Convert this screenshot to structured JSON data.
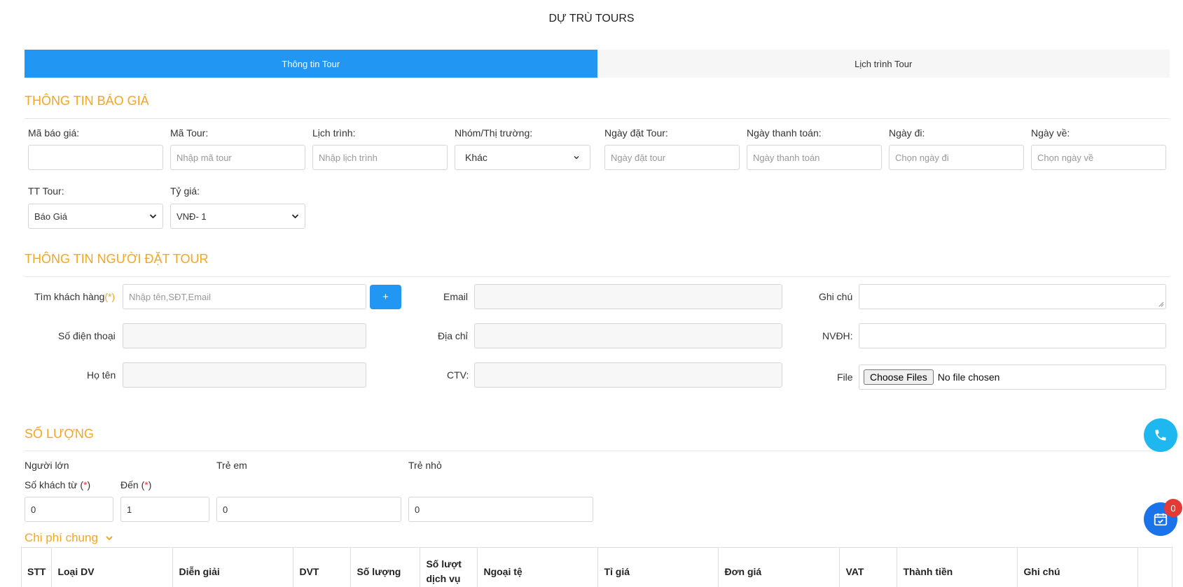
{
  "page": {
    "title": "DỰ TRÙ TOURS"
  },
  "tabs": [
    {
      "label": "Thông tin Tour",
      "active": true
    },
    {
      "label": "Lịch trình Tour",
      "active": false
    }
  ],
  "quote_section": {
    "title": "THÔNG TIN BÁO GIÁ",
    "fields": {
      "ma_bao_gia": {
        "label": "Mã báo giá:",
        "value": "",
        "placeholder": ""
      },
      "ma_tour": {
        "label": "Mã Tour:",
        "placeholder": "Nhập mã tour"
      },
      "lich_trinh": {
        "label": "Lịch trình:",
        "placeholder": "Nhập lịch trình"
      },
      "nhom_thi_truong": {
        "label": "Nhóm/Thị trường:",
        "selected": "Khác"
      },
      "ngay_dat_tour": {
        "label": "Ngày đặt Tour:",
        "placeholder": "Ngày đặt tour"
      },
      "ngay_thanh_toan": {
        "label": "Ngày thanh toán:",
        "placeholder": "Ngày thanh toán"
      },
      "ngay_di": {
        "label": "Ngày đi:",
        "placeholder": "Chọn ngày đi"
      },
      "ngay_ve": {
        "label": "Ngày về:",
        "placeholder": "Chọn ngày về"
      },
      "tt_tour": {
        "label": "TT Tour:",
        "selected": "Báo Giá"
      },
      "ty_gia": {
        "label": "Tỷ giá:",
        "selected": "VNĐ- 1"
      }
    }
  },
  "booker_section": {
    "title": "THÔNG TIN NGƯỜI ĐẶT TOUR",
    "search_label": "Tìm khách hàng",
    "required_mark": "(*)",
    "search_placeholder": "Nhập tên,SĐT,Email",
    "add_button": "+",
    "phone_label": "Số điện thoại",
    "name_label": "Họ tên",
    "email_label": "Email",
    "address_label": "Địa chỉ",
    "ctv_label": "CTV:",
    "note_label": "Ghi chú",
    "nvdh_label": "NVĐH:",
    "file_label": "File",
    "file_button": "Choose Files",
    "file_status": "No file chosen"
  },
  "quantity_section": {
    "title": "SỐ LƯỢNG",
    "adults_label": "Người lớn",
    "children_label": "Trẻ em",
    "infants_label": "Trẻ nhỏ",
    "from_label": "Số khách từ (",
    "from_req": "*",
    "to_label": "Đến (",
    "to_req": "*",
    "close_paren": ")",
    "from_value": "0",
    "to_value": "1",
    "children_value": "0",
    "infants_value": "0"
  },
  "general_costs": {
    "title": "Chi phí chung",
    "columns": [
      "STT",
      "Loại DV",
      "Diễn giải",
      "DVT",
      "Số lượng",
      "Số lượt dịch vụ",
      "Ngoại tệ",
      "Tỉ giá",
      "Đơn giá",
      "VAT",
      "Thành tiền",
      "Ghi chú",
      ""
    ]
  },
  "floating": {
    "cart_count": "0"
  },
  "icons": [
    "chevron-down-icon",
    "phone-icon",
    "calendar-check-icon"
  ],
  "colors": {
    "primary": "#2196f3",
    "section_title": "#f5a623",
    "required": "#e53935",
    "badge": "#e53935"
  }
}
